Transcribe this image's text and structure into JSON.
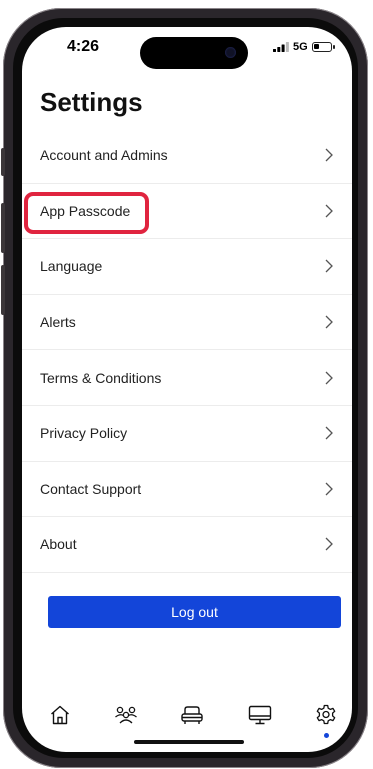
{
  "status_bar": {
    "time": "4:26",
    "network": "5G",
    "battery_level": 0.35
  },
  "page": {
    "title": "Settings"
  },
  "menu": {
    "items": [
      {
        "label": "Account and Admins",
        "icon": "chevron-right-icon"
      },
      {
        "label": "App Passcode",
        "icon": "chevron-right-icon",
        "highlighted": true
      },
      {
        "label": "Language",
        "icon": "chevron-right-icon"
      },
      {
        "label": "Alerts",
        "icon": "chevron-right-icon"
      },
      {
        "label": "Terms & Conditions",
        "icon": "chevron-right-icon"
      },
      {
        "label": "Privacy Policy",
        "icon": "chevron-right-icon"
      },
      {
        "label": "Contact Support",
        "icon": "chevron-right-icon"
      },
      {
        "label": "About",
        "icon": "chevron-right-icon"
      }
    ]
  },
  "actions": {
    "logout_label": "Log out"
  },
  "tab_bar": {
    "tabs": [
      {
        "icon": "home-icon",
        "active": false
      },
      {
        "icon": "users-icon",
        "active": false
      },
      {
        "icon": "vehicle-icon",
        "active": false
      },
      {
        "icon": "monitor-icon",
        "active": false
      },
      {
        "icon": "gear-icon",
        "active": true
      }
    ]
  },
  "colors": {
    "accent": "#1345d9",
    "highlight_border": "#e0243f",
    "text": "#222222",
    "divider": "#ececec"
  }
}
